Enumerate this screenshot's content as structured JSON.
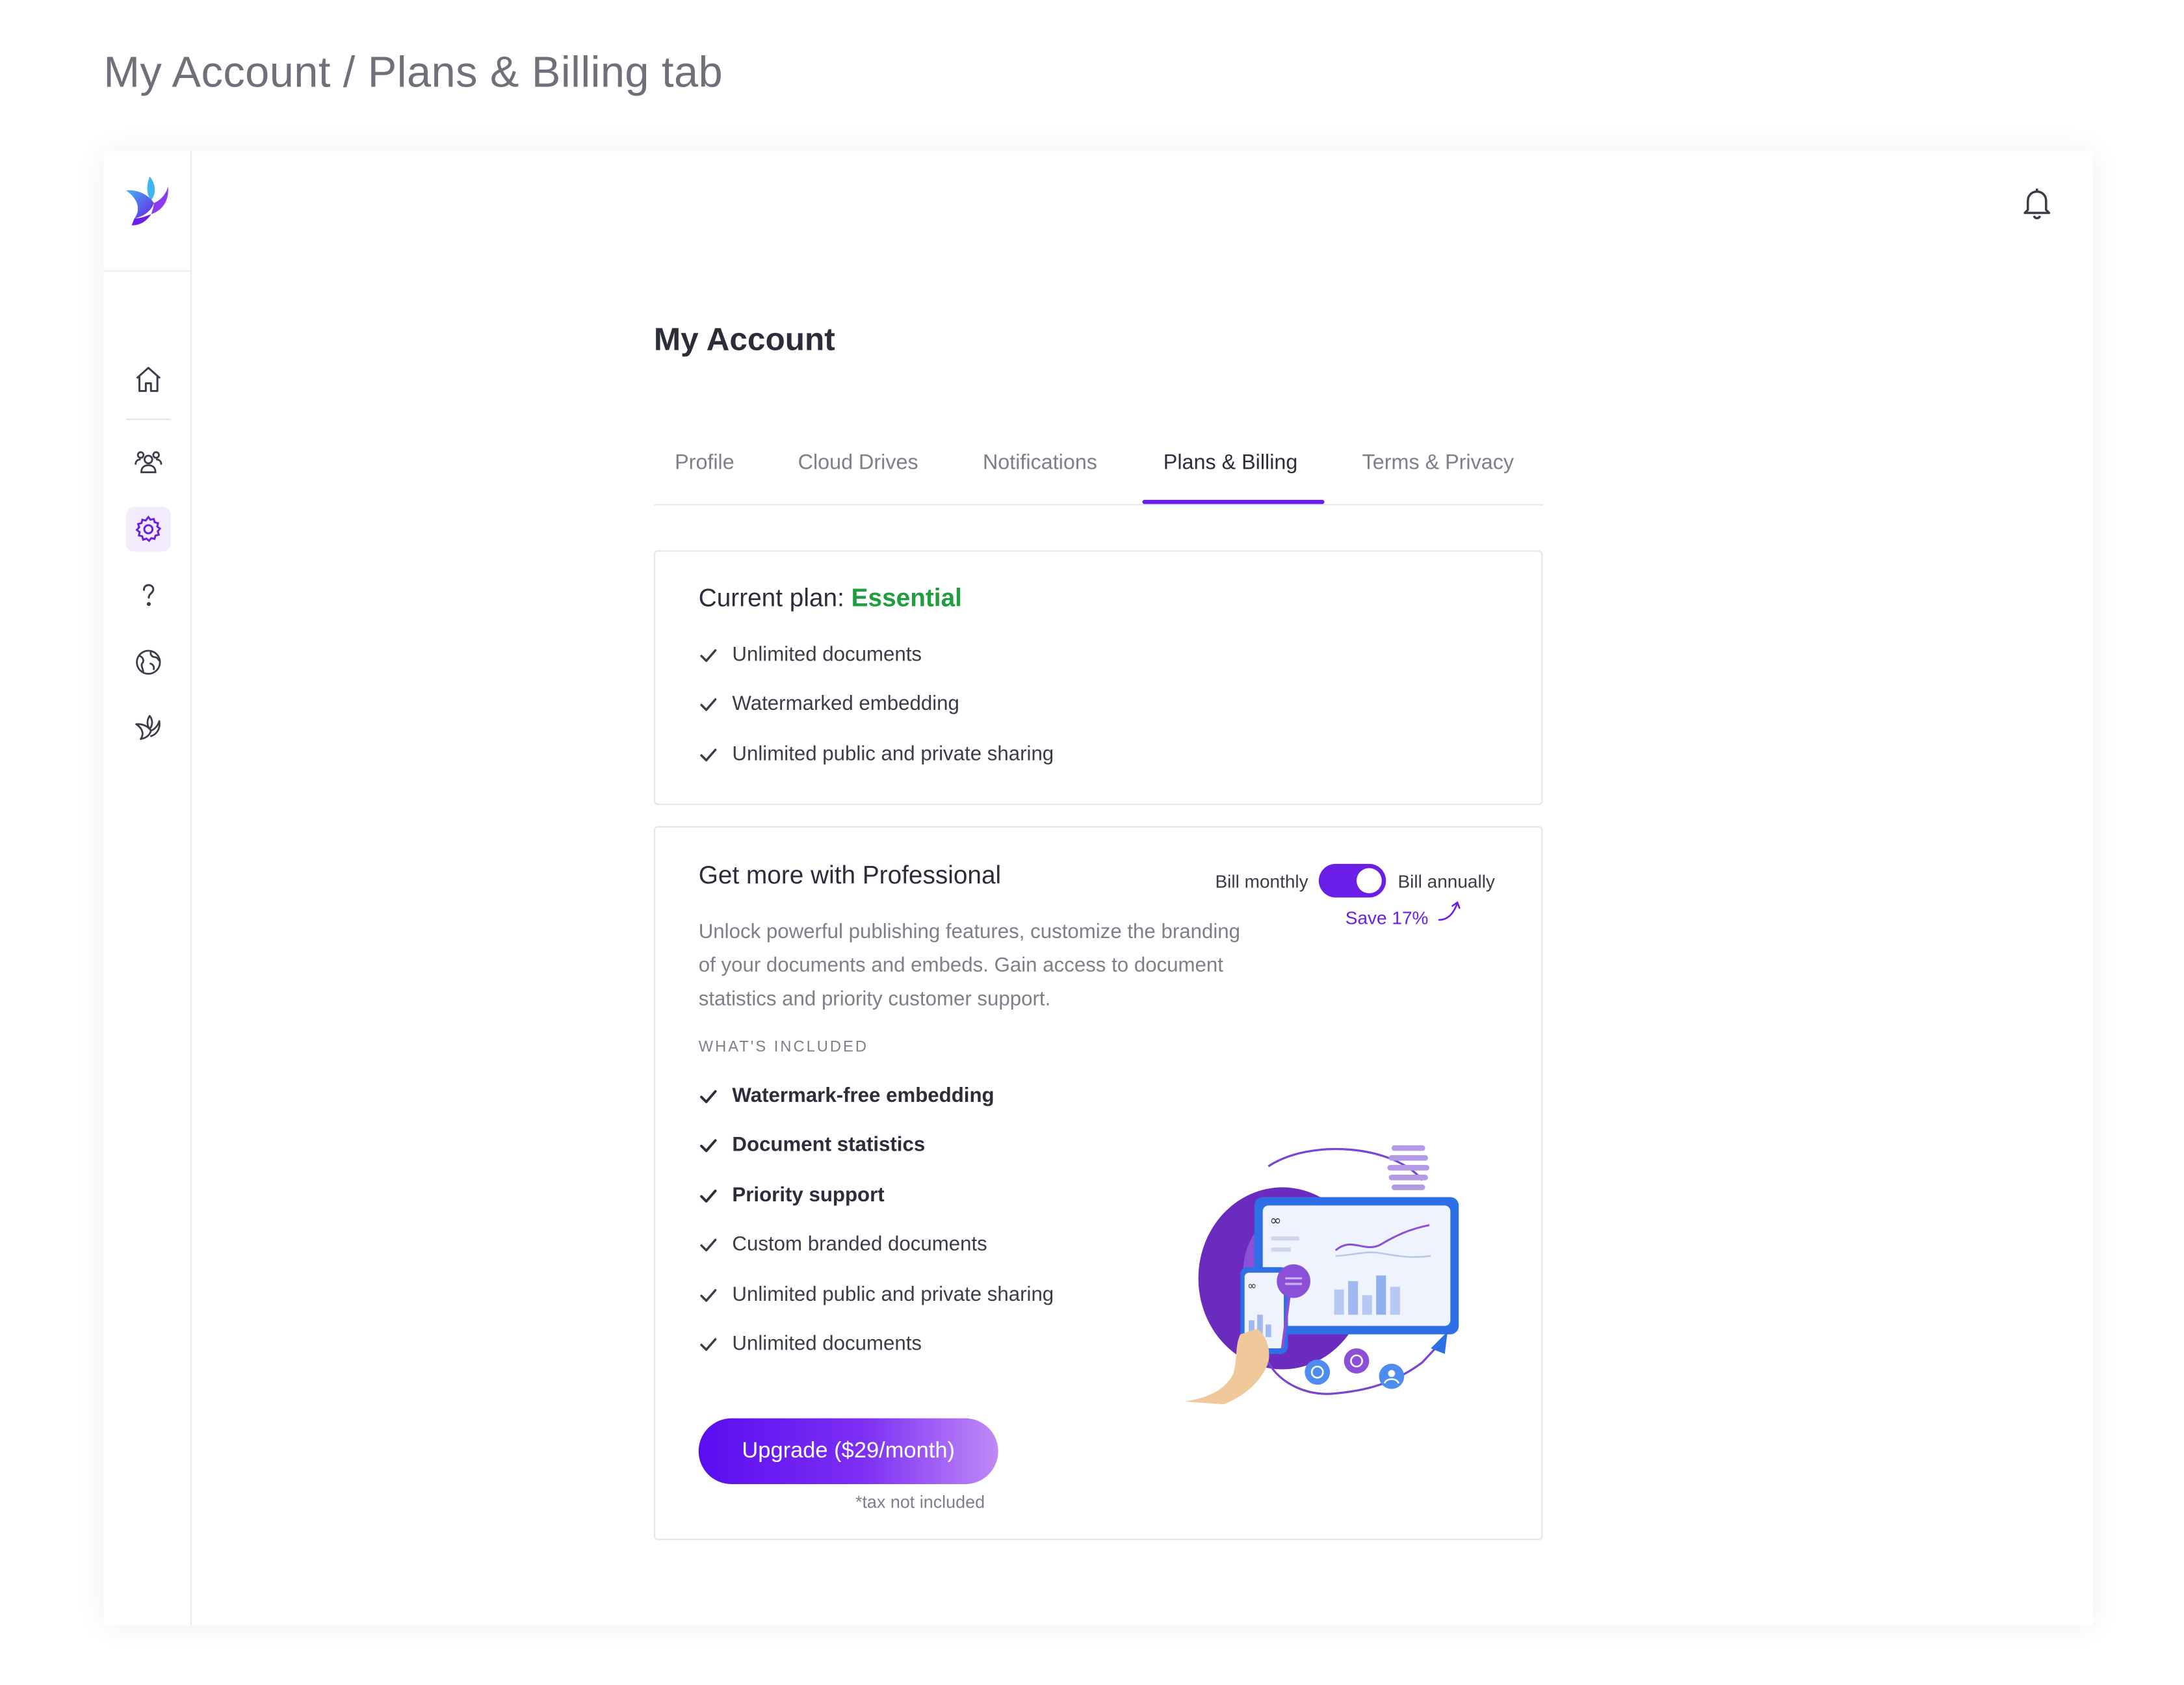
{
  "page_heading": "My Account / Plans & Billing tab",
  "header": {
    "notifications_icon": "bell-icon"
  },
  "sidebar": {
    "logo": "bird-logo",
    "items": [
      {
        "icon": "home-icon",
        "active": false
      },
      {
        "icon": "users-icon",
        "active": false
      },
      {
        "icon": "gear-icon",
        "active": true
      },
      {
        "icon": "question-mark-icon",
        "active": false
      },
      {
        "icon": "globe-icon",
        "active": false
      },
      {
        "icon": "bird-icon",
        "active": false
      }
    ]
  },
  "main": {
    "title": "My Account",
    "tabs": [
      {
        "label": "Profile",
        "active": false
      },
      {
        "label": "Cloud Drives",
        "active": false
      },
      {
        "label": "Notifications",
        "active": false
      },
      {
        "label": "Plans & Billing",
        "active": true
      },
      {
        "label": "Terms & Privacy",
        "active": false
      }
    ],
    "current_plan": {
      "prefix": "Current plan:",
      "name": "Essential",
      "features": [
        "Unlimited documents",
        "Watermarked embedding",
        "Unlimited public and private sharing"
      ]
    },
    "upgrade_card": {
      "title": "Get more with Professional",
      "bill_monthly": "Bill monthly",
      "bill_annually": "Bill annually",
      "annual_selected": true,
      "save_label": "Save 17%",
      "description": "Unlock powerful publishing features, customize the branding of your documents and embeds. Gain access to document statistics and priority customer support.",
      "included_heading": "WHAT'S INCLUDED",
      "features": [
        {
          "label": "Watermark-free embedding",
          "bold": true
        },
        {
          "label": "Document statistics",
          "bold": true
        },
        {
          "label": "Priority support",
          "bold": true
        },
        {
          "label": "Custom branded documents",
          "bold": false
        },
        {
          "label": "Unlimited public and private sharing",
          "bold": false
        },
        {
          "label": "Unlimited documents",
          "bold": false
        }
      ],
      "upgrade_button": "Upgrade ($29/month)",
      "tax_note": "*tax not included",
      "accent_color": "#6a1ee8",
      "plan_color": "#1f9d3f"
    }
  }
}
